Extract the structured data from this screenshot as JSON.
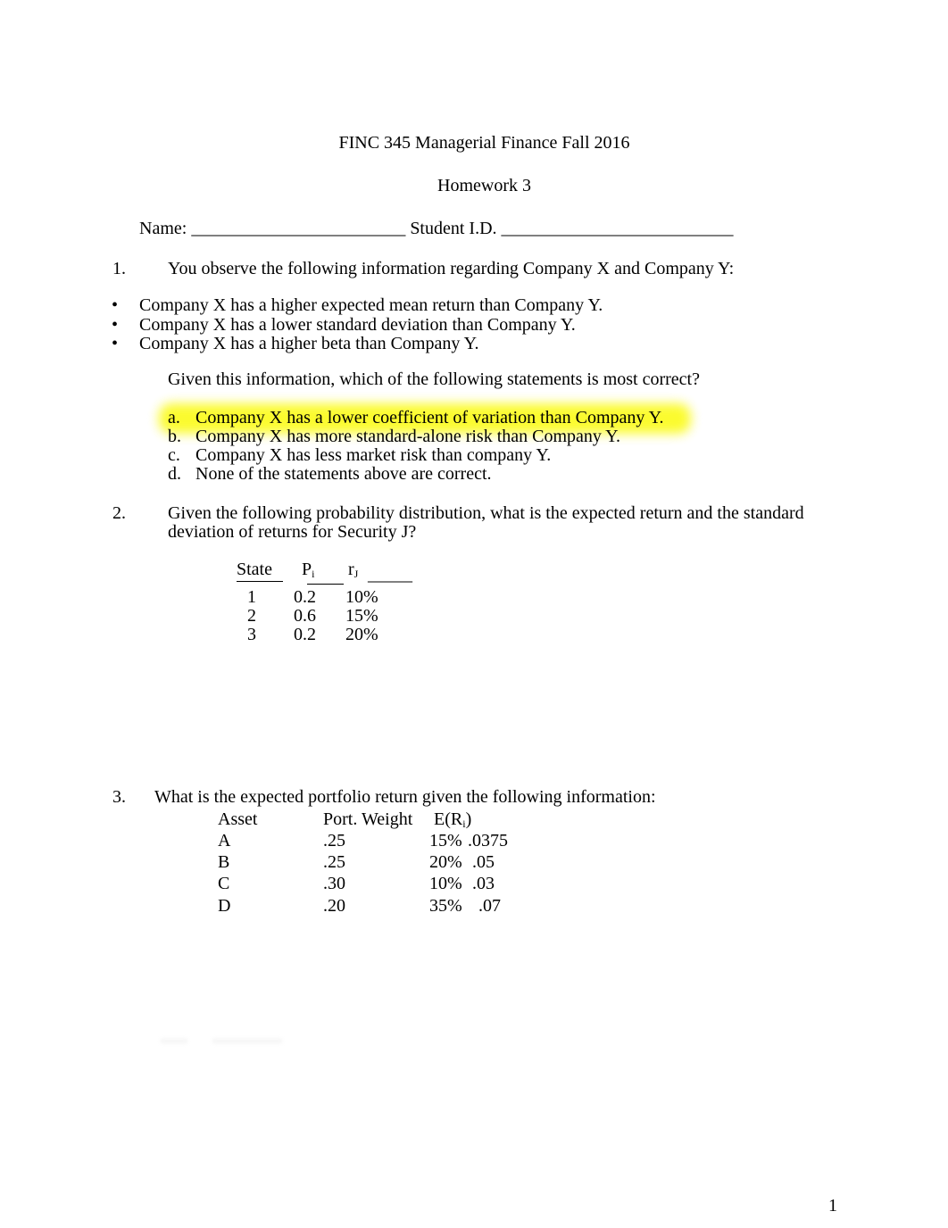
{
  "header": {
    "title": "FINC 345 Managerial Finance Fall 2016",
    "subtitle": "Homework 3",
    "name_label": "Name:",
    "name_blank": "________________________",
    "student_id_label": "Student I.D.",
    "student_id_blank": "__________________________"
  },
  "q1": {
    "number": "1.",
    "prompt": "You observe the following information regarding Company X and Company Y:",
    "bullets": [
      "Company X has a higher expected mean return than Company Y.",
      "Company X has a lower standard deviation than Company Y.",
      "Company X has a higher beta than Company Y."
    ],
    "bullet_glyph": "•",
    "question": "Given this information, which of the following statements is most correct?",
    "options": [
      {
        "letter": "a.",
        "text": "Company X has a lower coefficient of variation than Company Y.",
        "highlighted": true
      },
      {
        "letter": "b.",
        "text": "Company X has more standard-alone risk than Company Y.",
        "highlighted": false
      },
      {
        "letter": "c.",
        "text": "Company X has less market risk than company Y.",
        "highlighted": false
      },
      {
        "letter": "d.",
        "text": "None of the statements above are correct.",
        "highlighted": false
      }
    ],
    "highlight_color": "#fbfb24"
  },
  "q2": {
    "number": "2.",
    "prompt_line1": "Given the following probability distribution, what is the expected return and the standard",
    "prompt_line2": "deviation of returns for Security J?",
    "table": {
      "headers": {
        "state": "State",
        "p_main": "P",
        "p_sub": "i",
        "r_main": "r",
        "r_sub": "J",
        "blank": "_____"
      },
      "rows": [
        {
          "state": "1",
          "p": "0.2",
          "r": "10%"
        },
        {
          "state": "2",
          "p": "0.6",
          "r": "15%"
        },
        {
          "state": "3",
          "p": "0.2",
          "r": "20%"
        }
      ]
    }
  },
  "q3": {
    "number": "3.",
    "prompt": "What is the expected portfolio return given the following information:",
    "table": {
      "headers": {
        "asset": "Asset",
        "weight": "Port. Weight",
        "er_main": "E(R",
        "er_sub": "i",
        "er_close": ")"
      },
      "rows": [
        {
          "asset": "A",
          "weight": ".25",
          "er": "15%",
          "note": ".0375"
        },
        {
          "asset": "B",
          "weight": ".25",
          "er": "20%",
          "note": ".05"
        },
        {
          "asset": "C",
          "weight": ".30",
          "er": "10%",
          "note": ".03"
        },
        {
          "asset": "D",
          "weight": ".20",
          "er": "35%",
          "note": ".07"
        }
      ]
    }
  },
  "footer": {
    "page_number": "1"
  }
}
